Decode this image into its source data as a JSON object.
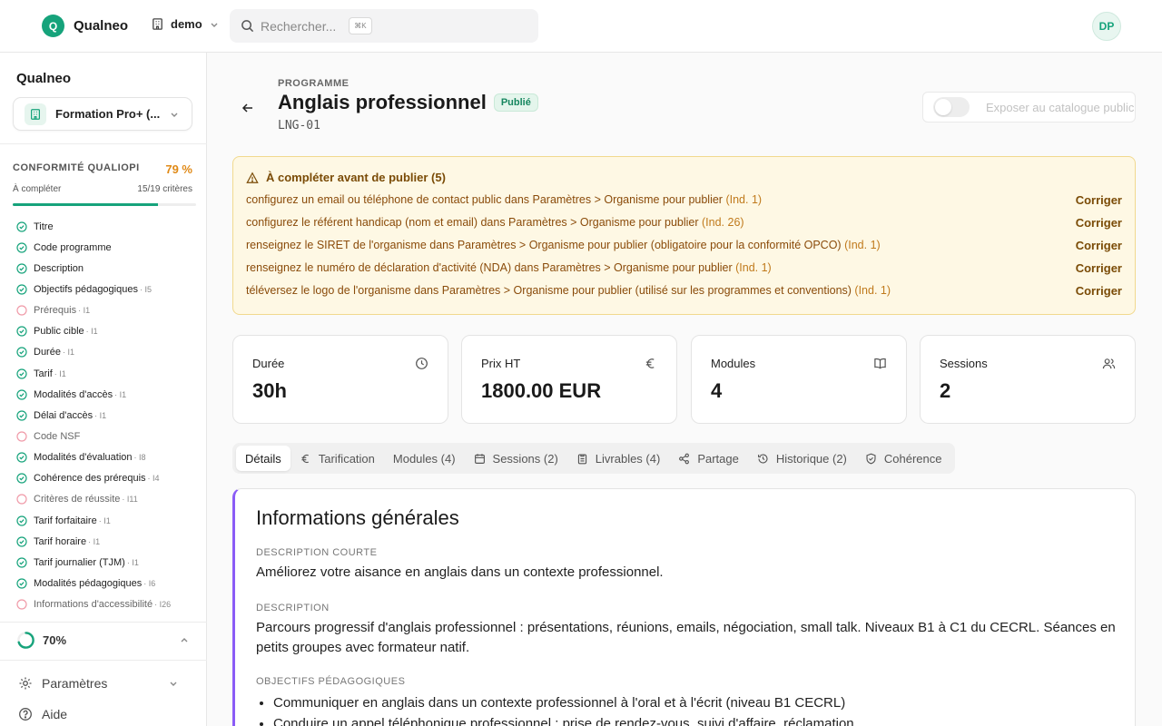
{
  "topbar": {
    "brand_initial": "Q",
    "brand_name": "Qualneo",
    "workspace": "demo",
    "search_placeholder": "Rechercher...",
    "search_shortcut": "⌘K",
    "user_initials": "DP"
  },
  "sidebar": {
    "title": "Qualneo",
    "organization": "Formation Pro+ (...",
    "qualiopi": {
      "label": "CONFORMITÉ QUALIOPI",
      "percent": "79 %",
      "sub_label": "À compléter",
      "count": "15/19 critères",
      "progress_fraction": 0.79
    },
    "criteria": [
      {
        "label": "Titre",
        "ind": "",
        "done": true
      },
      {
        "label": "Code programme",
        "ind": "",
        "done": true
      },
      {
        "label": "Description",
        "ind": "",
        "done": true
      },
      {
        "label": "Objectifs pédagogiques",
        "ind": "· I5",
        "done": true
      },
      {
        "label": "Prérequis",
        "ind": "· I1",
        "done": false
      },
      {
        "label": "Public cible",
        "ind": "· I1",
        "done": true
      },
      {
        "label": "Durée",
        "ind": "· I1",
        "done": true
      },
      {
        "label": "Tarif",
        "ind": "· I1",
        "done": true
      },
      {
        "label": "Modalités d'accès",
        "ind": "· I1",
        "done": true
      },
      {
        "label": "Délai d'accès",
        "ind": "· I1",
        "done": true
      },
      {
        "label": "Code NSF",
        "ind": "",
        "done": false
      },
      {
        "label": "Modalités d'évaluation",
        "ind": "· I8",
        "done": true
      },
      {
        "label": "Cohérence des prérequis",
        "ind": "· I4",
        "done": true
      },
      {
        "label": "Critères de réussite",
        "ind": "· I11",
        "done": false
      },
      {
        "label": "Tarif forfaitaire",
        "ind": "· I1",
        "done": true
      },
      {
        "label": "Tarif horaire",
        "ind": "· I1",
        "done": true
      },
      {
        "label": "Tarif journalier (TJM)",
        "ind": "· I1",
        "done": true
      },
      {
        "label": "Modalités pédagogiques",
        "ind": "· I6",
        "done": true
      },
      {
        "label": "Informations d'accessibilité",
        "ind": "· I26",
        "done": false
      }
    ],
    "score": {
      "label": "70%",
      "fraction": 0.7
    },
    "settings_label": "Paramètres",
    "help_label": "Aide"
  },
  "header": {
    "eyebrow": "PROGRAMME",
    "title": "Anglais professionnel",
    "status": "Publié",
    "code": "LNG-01",
    "catalog_toggle_label": "Exposer au catalogue public",
    "catalog_toggle_on": false
  },
  "alert": {
    "title": "À compléter avant de publier (5)",
    "fix_label": "Corriger",
    "items": [
      {
        "text": "configurez un email ou téléphone de contact public dans Paramètres > Organisme pour publier",
        "ind": "(Ind. 1)"
      },
      {
        "text": "configurez le référent handicap (nom et email) dans Paramètres > Organisme pour publier",
        "ind": "(Ind. 26)"
      },
      {
        "text": "renseignez le SIRET de l'organisme dans Paramètres > Organisme pour publier (obligatoire pour la conformité OPCO)",
        "ind": "(Ind. 1)"
      },
      {
        "text": "renseignez le numéro de déclaration d'activité (NDA) dans Paramètres > Organisme pour publier",
        "ind": "(Ind. 1)"
      },
      {
        "text": "téléversez le logo de l'organisme dans Paramètres > Organisme pour publier (utilisé sur les programmes et conventions)",
        "ind": "(Ind. 1)"
      }
    ]
  },
  "stats": [
    {
      "label": "Durée",
      "value": "30h",
      "icon": "clock-icon"
    },
    {
      "label": "Prix HT",
      "value": "1800.00 EUR",
      "icon": "euro-icon"
    },
    {
      "label": "Modules",
      "value": "4",
      "icon": "book-icon"
    },
    {
      "label": "Sessions",
      "value": "2",
      "icon": "users-icon"
    }
  ],
  "tabs": [
    {
      "label": "Détails",
      "active": true,
      "icon": ""
    },
    {
      "label": "Tarification",
      "active": false,
      "icon": "euro-icon"
    },
    {
      "label": "Modules (4)",
      "active": false,
      "icon": ""
    },
    {
      "label": "Sessions (2)",
      "active": false,
      "icon": "calendar-icon"
    },
    {
      "label": "Livrables (4)",
      "active": false,
      "icon": "clipboard-icon"
    },
    {
      "label": "Partage",
      "active": false,
      "icon": "share-icon"
    },
    {
      "label": "Historique (2)",
      "active": false,
      "icon": "history-icon"
    },
    {
      "label": "Cohérence",
      "active": false,
      "icon": "shield-icon"
    }
  ],
  "details": {
    "title": "Informations générales",
    "short_description_label": "DESCRIPTION COURTE",
    "short_description": "Améliorez votre aisance en anglais dans un contexte professionnel.",
    "description_label": "DESCRIPTION",
    "description": "Parcours progressif d'anglais professionnel : présentations, réunions, emails, négociation, small talk. Niveaux B1 à C1 du CECRL. Séances en petits groupes avec formateur natif.",
    "objectives_label": "OBJECTIFS PÉDAGOGIQUES",
    "objectives": [
      "Communiquer en anglais dans un contexte professionnel à l'oral et à l'écrit (niveau B1 CECRL)",
      "Conduire un appel téléphonique professionnel : prise de rendez-vous, suivi d'affaire, réclamation"
    ]
  }
}
